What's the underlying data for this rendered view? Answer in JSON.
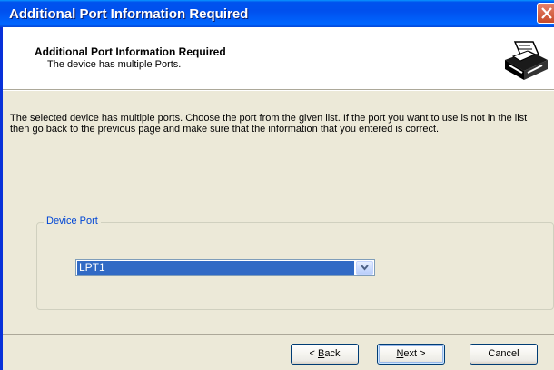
{
  "window": {
    "title": "Additional Port Information Required"
  },
  "header": {
    "title": "Additional Port Information Required",
    "subtitle": "The device has multiple Ports.",
    "icon": "printer-icon"
  },
  "body": {
    "description": "The selected device has multiple ports.  Choose the port from the given list.  If the port you want to use is not in the list then go back to the previous page and make sure that the information that you entered is correct."
  },
  "port_group": {
    "legend": "Device Port",
    "selected_value": "LPT1"
  },
  "buttons": {
    "back": {
      "accel": "B",
      "rest": "ack",
      "prefix": "< "
    },
    "next": {
      "accel": "N",
      "rest": "ext",
      "suffix": " >"
    },
    "cancel": "Cancel"
  },
  "colors": {
    "titlebar": "#0053EE",
    "dialog_bg": "#ECE9D8",
    "selection": "#316AC5",
    "group_legend": "#0046D5"
  }
}
